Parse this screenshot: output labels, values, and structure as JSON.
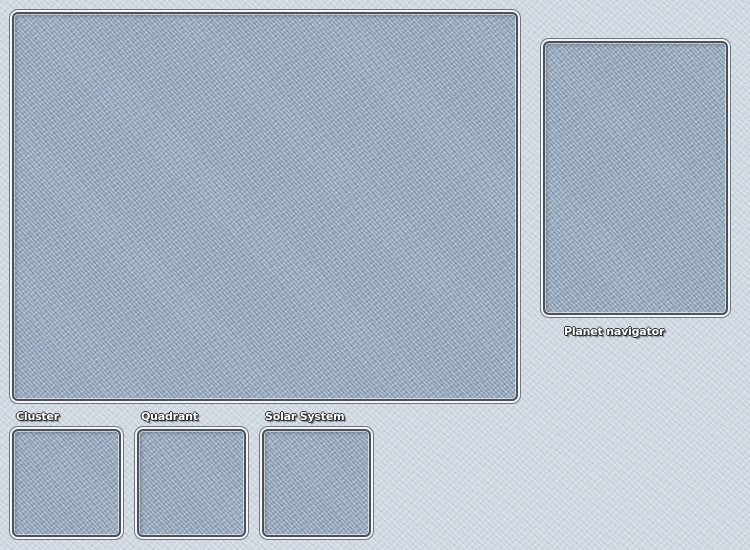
{
  "views": {
    "planet_navigator": {
      "label": "Planet navigator"
    },
    "cluster": {
      "label": "Cluster"
    },
    "quadrant": {
      "label": "Quadrant"
    },
    "solar_system": {
      "label": "Solar System"
    }
  }
}
